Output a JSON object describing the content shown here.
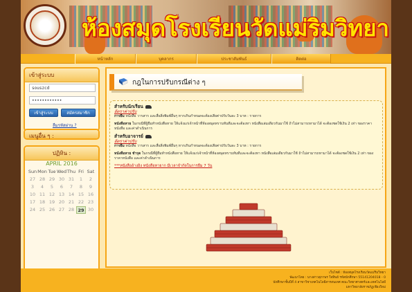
{
  "header": {
    "site_title": "ห้องสมุดโรงเรียนวัดแม่ริมวิทยา"
  },
  "nav": {
    "items": [
      {
        "label": "หน้าหลัก"
      },
      {
        "label": "บุคลากร"
      },
      {
        "label": "ประชาสัมพันธ์"
      },
      {
        "label": "ติดต่อ"
      }
    ]
  },
  "login": {
    "title": "เข้าสู่ระบบ",
    "username_value": "souszcd",
    "password_value": "••••••••••••",
    "login_button": "เข้าสู่ระบบ",
    "register_button": "สมัครสมาชิก",
    "forgot_link": "ลืมรหัสผ่าน ?"
  },
  "menu": {
    "title": "เมนูอื่น ๆ :"
  },
  "calendar": {
    "title": "ปฏิทิน :",
    "month": "APRIL 2016",
    "weekdays": [
      "Sun",
      "Mon",
      "Tue",
      "Wed",
      "Thu",
      "Fri",
      "Sat"
    ],
    "days": [
      "27",
      "28",
      "29",
      "30",
      "31",
      "1",
      "2",
      "3",
      "4",
      "5",
      "6",
      "7",
      "8",
      "9",
      "10",
      "11",
      "12",
      "13",
      "14",
      "15",
      "16",
      "17",
      "18",
      "19",
      "20",
      "21",
      "22",
      "23",
      "24",
      "25",
      "26",
      "27",
      "28",
      "29",
      "30"
    ],
    "today": "29"
  },
  "content": {
    "title": "กฎในการปรับกรณีต่าง ๆ",
    "students": {
      "heading": "สำหรับนักเรียน",
      "sub": "อัตราค่าปรับ",
      "rule1_label": "การยืม",
      "rule1_text": "หนังสือ วารสาร และสื่อสิ่งพิมพ์อื่นๆ หากเกินกำหนดจะต้องเสียค่าปรับวันละ 3 บาท : รายการ",
      "rule2_label": "หนังสือหาย",
      "rule2_text": "ในกรณีที่ผู้ยืมทำหนังสือหาย ให้แจ้งแก่เจ้าหน้าที่ห้องสมุดทราบทันทีและจะต้องหา หนังสือเล่มเดียวกันมาใช้ ถ้าไม่สามารถหามาได้ จะต้องชดใช้เงิน 2 เท่า ของราคาหนังสือ และค่าดำเนินการ"
    },
    "teachers": {
      "heading": "สำหรับอาจารย์",
      "sub": "อัตราค่าปรับ",
      "rule1_label": "การยืม",
      "rule1_text": "หนังสือ วารสาร และสื่อสิ่งพิมพ์อื่นๆ หากเกินกำหนดจะต้องเสียค่าปรับวันละ 3 บาท : รายการ",
      "rule2_label": "หนังสือหาย ชำรุด",
      "rule2_text": "ในกรณีที่ผู้ยืมทำหนังสือหาย ให้แจ้งแก่เจ้าหน้าที่ห้องสมุดทราบทันทีและจะต้องหา หนังสือเล่มเดียวกันมาใช้ ถ้าไม่สามารถหามาได้ จะต้องชดใช้เงิน 2 เท่า ของราคาหนังสือ และค่าดำเนินการ"
    },
    "more_link": "***หนังสืออ้างอิง หนังสือหายาก มีเวลาจำกัดในการยืม 7 วัน"
  },
  "footer": {
    "line1": "เว็บไซต์ : ห้องสมุดโรงเรียนวัดแม่ริมวิทยา",
    "line2": "พัฒนาโดย : นางสาวสุภาพร ใจทิพย์ รหัสนักศึกษา 55141204018 - 0",
    "line3": "นักศึกษาชั้นปีที่ 4 สาขาวิชาเทคโนโลยีสารสนเทศ คณะวิทยาศาสตร์และเทคโนโลยี",
    "line4": "มหาวิทยาลัยราชภัฏเชียงใหม่"
  },
  "colors": {
    "accent": "#f7b21f",
    "title_yellow": "#ffe400",
    "title_red": "#c81010",
    "background": "#5a3418"
  }
}
